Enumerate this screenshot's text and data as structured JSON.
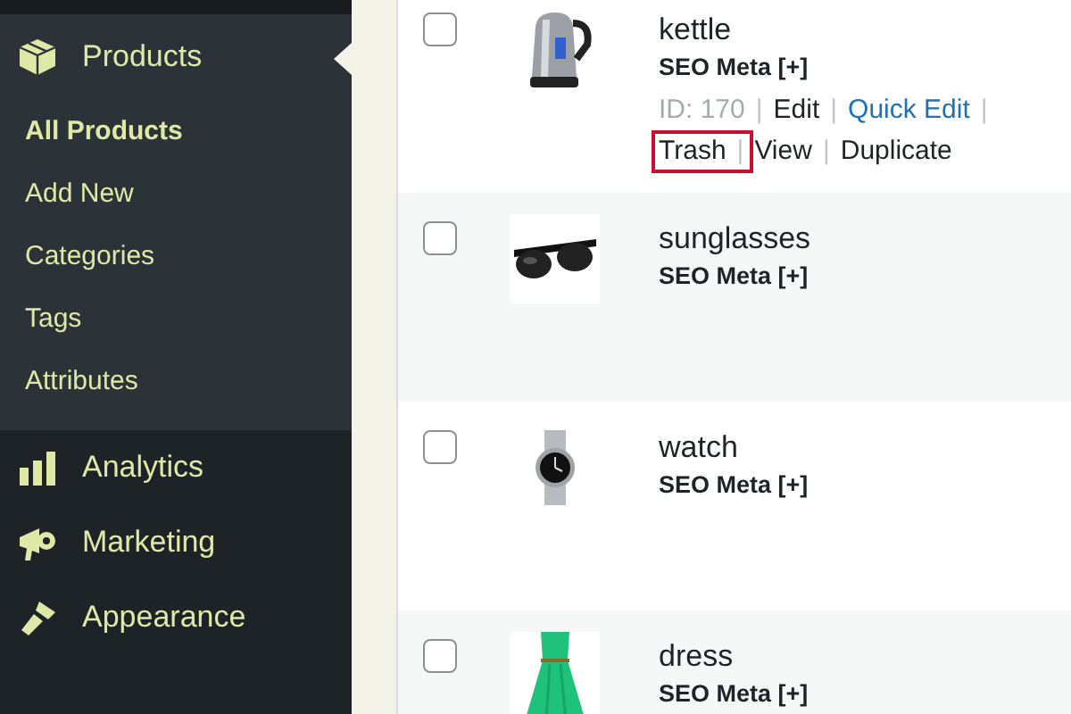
{
  "sidebar": {
    "items": [
      {
        "label": "Products",
        "kind": "box",
        "selected": true,
        "children": [
          {
            "label": "All Products",
            "selected": true
          },
          {
            "label": "Add New",
            "selected": false
          },
          {
            "label": "Categories",
            "selected": false
          },
          {
            "label": "Tags",
            "selected": false
          },
          {
            "label": "Attributes",
            "selected": false
          }
        ]
      },
      {
        "label": "Analytics",
        "kind": "bars",
        "selected": false
      },
      {
        "label": "Marketing",
        "kind": "megaphone",
        "selected": false
      },
      {
        "label": "Appearance",
        "kind": "brush",
        "selected": false
      }
    ]
  },
  "products": [
    {
      "name": "kettle",
      "kind": "kettle",
      "checked": false,
      "seo": "SEO Meta [+]",
      "actions": [
        {
          "kind": "id",
          "text": "ID: 170",
          "highlighted": false
        },
        {
          "kind": "sep",
          "text": "|",
          "highlighted": false
        },
        {
          "kind": "link",
          "text": "Edit",
          "highlighted": false
        },
        {
          "kind": "sep",
          "text": "|",
          "highlighted": false
        },
        {
          "kind": "blue",
          "text": "Quick Edit",
          "highlighted": false
        },
        {
          "kind": "sep",
          "text": "|",
          "highlighted": false
        },
        {
          "kind": "link",
          "text": "Trash",
          "highlighted": true
        },
        {
          "kind": "sep",
          "text": "|",
          "highlighted": true
        },
        {
          "kind": "link",
          "text": "View",
          "highlighted": false
        },
        {
          "kind": "sep",
          "text": "|",
          "highlighted": false
        },
        {
          "kind": "link",
          "text": "Duplicate",
          "highlighted": false
        }
      ]
    },
    {
      "name": "sunglasses",
      "kind": "sunglasses",
      "checked": false,
      "seo": "SEO Meta [+]"
    },
    {
      "name": "watch",
      "kind": "watch",
      "checked": false,
      "seo": "SEO Meta [+]"
    },
    {
      "name": "dress",
      "kind": "dress",
      "checked": false,
      "seo": "SEO Meta [+]"
    }
  ]
}
